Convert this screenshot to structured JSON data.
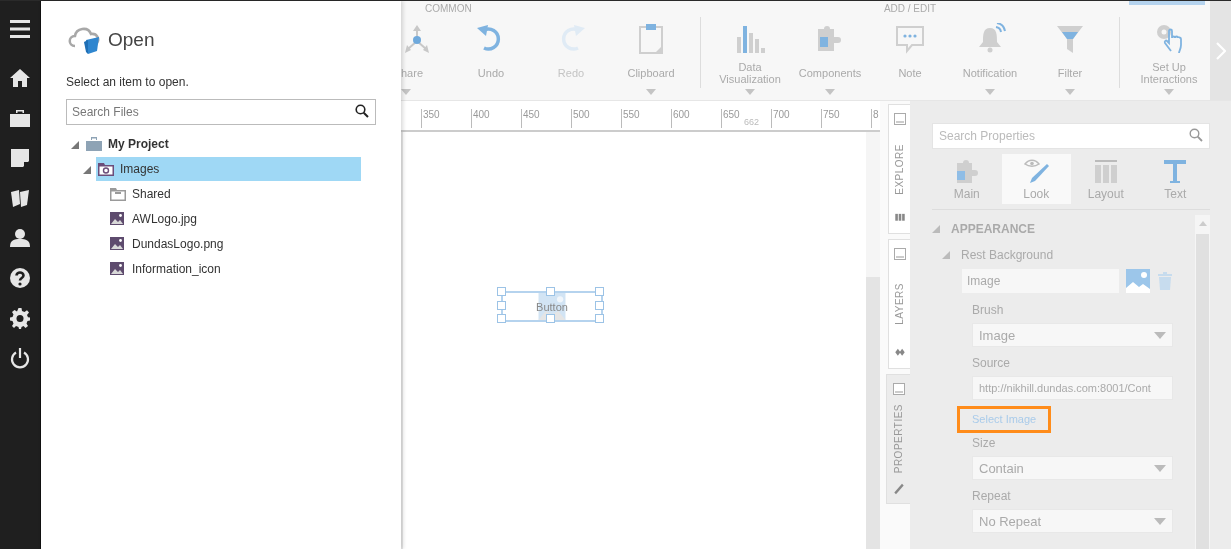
{
  "nav": [
    {
      "kind": "menu"
    },
    {
      "kind": "home"
    },
    {
      "kind": "briefcase"
    },
    {
      "kind": "note"
    },
    {
      "kind": "folders"
    },
    {
      "kind": "user"
    },
    {
      "kind": "help"
    },
    {
      "kind": "settings"
    },
    {
      "kind": "power"
    }
  ],
  "open_panel": {
    "title": "Open",
    "subtitle": "Select an item to open.",
    "search": {
      "placeholder": "Search Files"
    },
    "tree": [
      {
        "label": "My Project",
        "kind": "project",
        "expanded": true,
        "selected": false,
        "children": [
          {
            "label": "Images",
            "kind": "image-folder",
            "expanded": true,
            "selected": true,
            "children": [
              {
                "label": "Shared",
                "kind": "folder",
                "selected": false
              },
              {
                "label": "AWLogo.jpg",
                "kind": "image",
                "selected": false
              },
              {
                "label": "DundasLogo.png",
                "kind": "image",
                "selected": false
              },
              {
                "label": "Information_icon",
                "kind": "image",
                "selected": false
              }
            ]
          }
        ]
      }
    ]
  },
  "ribbon": {
    "groups": [
      {
        "title": "COMMON",
        "items": [
          {
            "label": "hare",
            "kind": "share",
            "disabled": false,
            "has_menu": true
          },
          {
            "label": "Undo",
            "kind": "undo",
            "disabled": false,
            "has_menu": false
          },
          {
            "label": "Redo",
            "kind": "redo",
            "disabled": true,
            "has_menu": false
          },
          {
            "label": "Clipboard",
            "kind": "clipboard",
            "disabled": false,
            "has_menu": true
          }
        ]
      },
      {
        "title": "ADD / EDIT",
        "items": [
          {
            "label": "Data Visualization",
            "kind": "chart",
            "disabled": false,
            "has_menu": true
          },
          {
            "label": "Components",
            "kind": "puzzle",
            "disabled": false,
            "has_menu": true
          },
          {
            "label": "Note",
            "kind": "note",
            "disabled": false,
            "has_menu": false
          },
          {
            "label": "Notification",
            "kind": "bell",
            "disabled": false,
            "has_menu": true
          },
          {
            "label": "Filter",
            "kind": "filter",
            "disabled": false,
            "has_menu": true
          }
        ]
      },
      {
        "items": [
          {
            "label": "Set Up Interactions",
            "kind": "interactions",
            "disabled": false,
            "has_menu": true
          }
        ]
      }
    ]
  },
  "canvas": {
    "ruler": {
      "ticks": [
        "350",
        "400",
        "450",
        "500",
        "550",
        "600",
        "650",
        "700",
        "750",
        "8"
      ],
      "marker": "662"
    },
    "element": {
      "label": "Button",
      "selected": true
    }
  },
  "side_tabs": [
    {
      "label": "EXPLORE",
      "kind": "explore",
      "selected": false
    },
    {
      "label": "LAYERS",
      "kind": "layers",
      "selected": false
    },
    {
      "label": "PROPERTIES",
      "kind": "properties",
      "selected": true
    }
  ],
  "properties": {
    "search": {
      "placeholder": "Search Properties"
    },
    "tabs": [
      {
        "label": "Main",
        "kind": "main",
        "selected": false
      },
      {
        "label": "Look",
        "kind": "look",
        "selected": true
      },
      {
        "label": "Layout",
        "kind": "layout",
        "selected": false
      },
      {
        "label": "Text",
        "kind": "text",
        "selected": false
      }
    ],
    "sections": [
      {
        "title": "APPEARANCE",
        "expanded": true,
        "groups": [
          {
            "title": "Rest Background",
            "expanded": true,
            "value": "Image",
            "rows": [
              {
                "kind": "dropdown",
                "label": "Brush",
                "value": "Image"
              },
              {
                "kind": "text",
                "label": "Source",
                "value": "http://nikhill.dundas.com:8001/Cont"
              },
              {
                "kind": "link",
                "label": "Select Image",
                "highlighted": true
              },
              {
                "kind": "dropdown",
                "label": "Size",
                "value": "Contain"
              },
              {
                "kind": "dropdown",
                "label": "Repeat",
                "value": "No Repeat"
              }
            ]
          }
        ]
      }
    ]
  }
}
